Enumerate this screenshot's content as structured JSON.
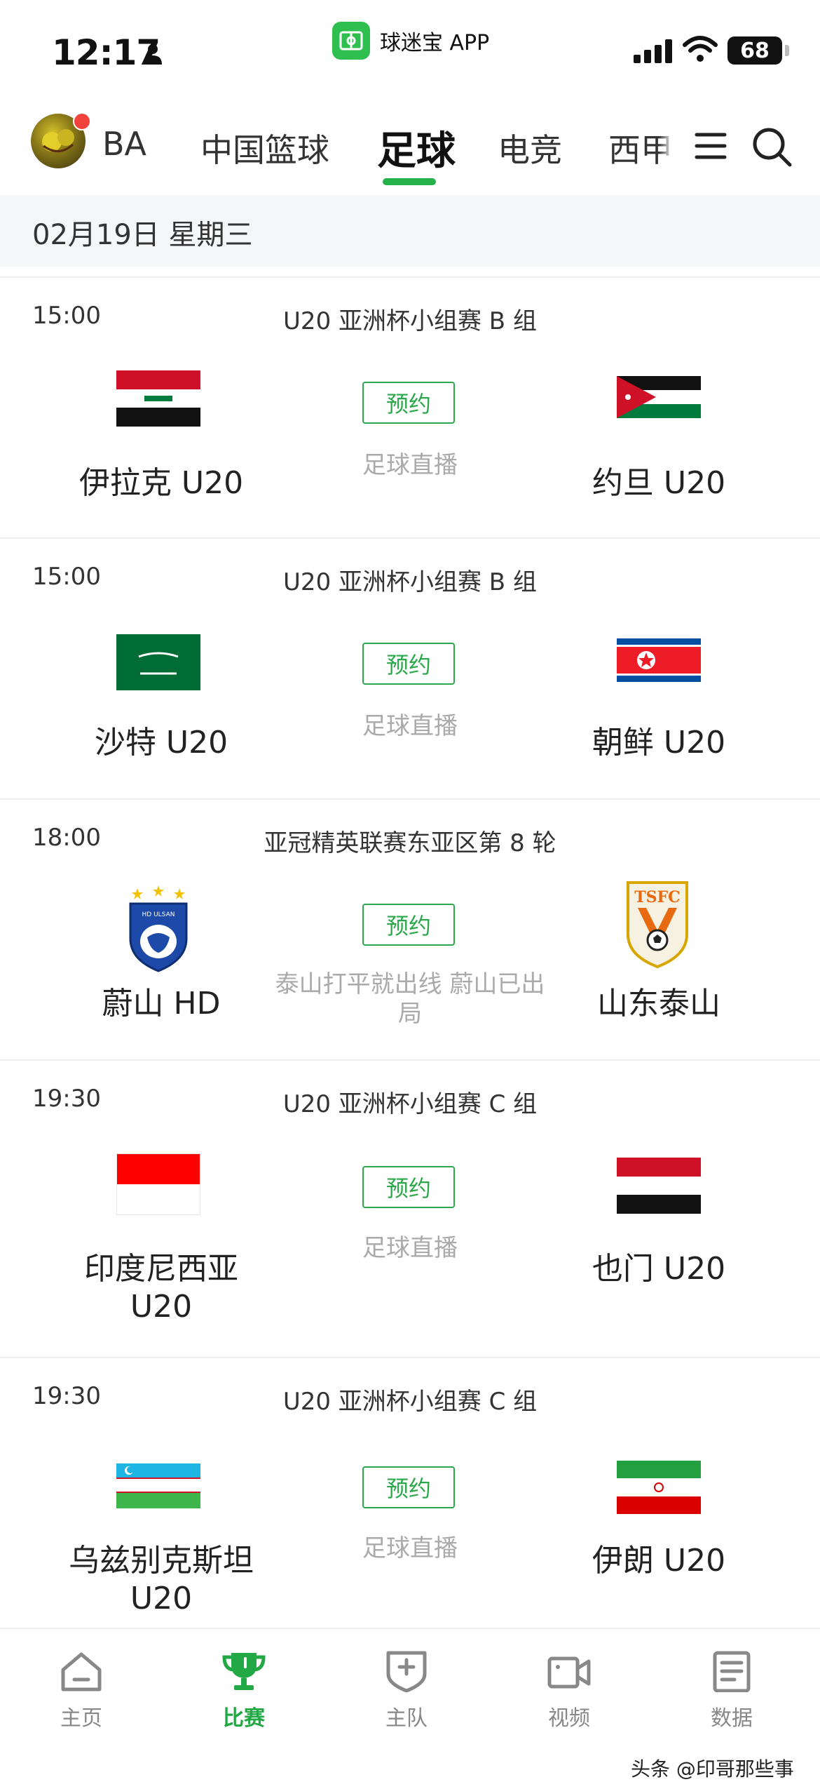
{
  "status_bar": {
    "time": "12:17",
    "app_label": "球迷宝 APP",
    "battery": "68"
  },
  "tabs": [
    {
      "label": "BA"
    },
    {
      "label": "中国篮球"
    },
    {
      "label": "足球"
    },
    {
      "label": "电竞"
    },
    {
      "label": "西甲"
    }
  ],
  "date": "02月19日 星期三",
  "matches": [
    {
      "time": "15:00",
      "competition": "U20 亚洲杯小组赛 B 组",
      "home": "伊拉克 U20",
      "away": "约旦 U20",
      "reserve_label": "预约",
      "note": "足球直播"
    },
    {
      "time": "15:00",
      "competition": "U20 亚洲杯小组赛 B 组",
      "home": "沙特 U20",
      "away": "朝鲜 U20",
      "reserve_label": "预约",
      "note": "足球直播"
    },
    {
      "time": "18:00",
      "competition": "亚冠精英联赛东亚区第 8 轮",
      "home": "蔚山 HD",
      "away": "山东泰山",
      "reserve_label": "预约",
      "note": "泰山打平就出线 蔚山已出局",
      "home_badge_text": "HD ULSAN",
      "away_badge_text": "TSFC"
    },
    {
      "time": "19:30",
      "competition": "U20 亚洲杯小组赛 C 组",
      "home": "印度尼西亚 U20",
      "away": "也门 U20",
      "reserve_label": "预约",
      "note": "足球直播"
    },
    {
      "time": "19:30",
      "competition": "U20 亚洲杯小组赛 C 组",
      "home": "乌兹别克斯坦 U20",
      "away": "伊朗 U20",
      "reserve_label": "预约",
      "note": "足球直播"
    }
  ],
  "bottom_nav": [
    {
      "label": "主页",
      "icon": "home-icon"
    },
    {
      "label": "比赛",
      "icon": "trophy-icon",
      "active": true
    },
    {
      "label": "主队",
      "icon": "team-shield-icon"
    },
    {
      "label": "视频",
      "icon": "video-icon"
    },
    {
      "label": "数据",
      "icon": "data-icon"
    }
  ],
  "watermark": "头条 @印哥那些事",
  "colors": {
    "accent": "#25b24a",
    "notification_dot": "#f1433c",
    "muted_text": "#aaaaaa"
  }
}
